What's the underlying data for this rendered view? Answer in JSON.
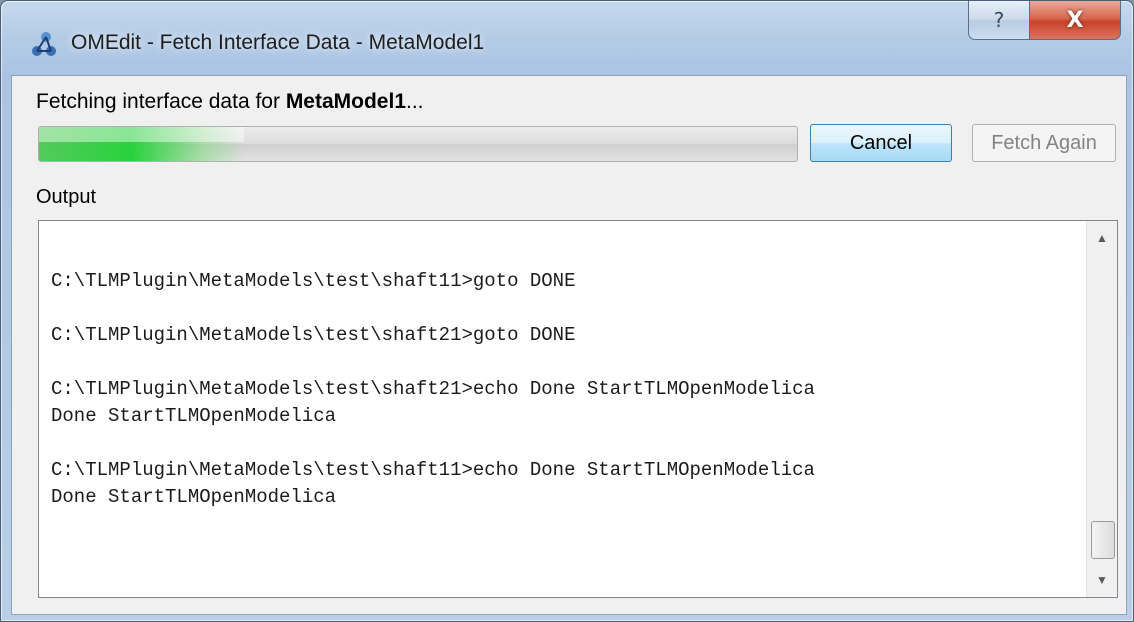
{
  "window": {
    "title": "OMEdit - Fetch Interface Data - MetaModel1",
    "help_glyph": "?",
    "close_glyph": "X"
  },
  "status": {
    "prefix": "Fetching interface data for ",
    "model_name": "MetaModel1",
    "suffix": "..."
  },
  "progress": {
    "fraction": 0.27
  },
  "buttons": {
    "cancel": "Cancel",
    "fetch_again": "Fetch Again"
  },
  "output": {
    "label": "Output",
    "lines": [
      "",
      "C:\\TLMPlugin\\MetaModels\\test\\shaft11>goto DONE",
      "",
      "C:\\TLMPlugin\\MetaModels\\test\\shaft21>goto DONE",
      "",
      "C:\\TLMPlugin\\MetaModels\\test\\shaft21>echo Done StartTLMOpenModelica",
      "Done StartTLMOpenModelica",
      "",
      "C:\\TLMPlugin\\MetaModels\\test\\shaft11>echo Done StartTLMOpenModelica",
      "Done StartTLMOpenModelica"
    ]
  },
  "colors": {
    "progress_fill": "#28d23c",
    "cancel_border": "#3c7fb1",
    "close_button": "#c8432a"
  },
  "icons": {
    "app": "omedit-app-icon",
    "scroll_up": "scroll-up-arrow-icon",
    "scroll_down": "scroll-down-arrow-icon"
  }
}
